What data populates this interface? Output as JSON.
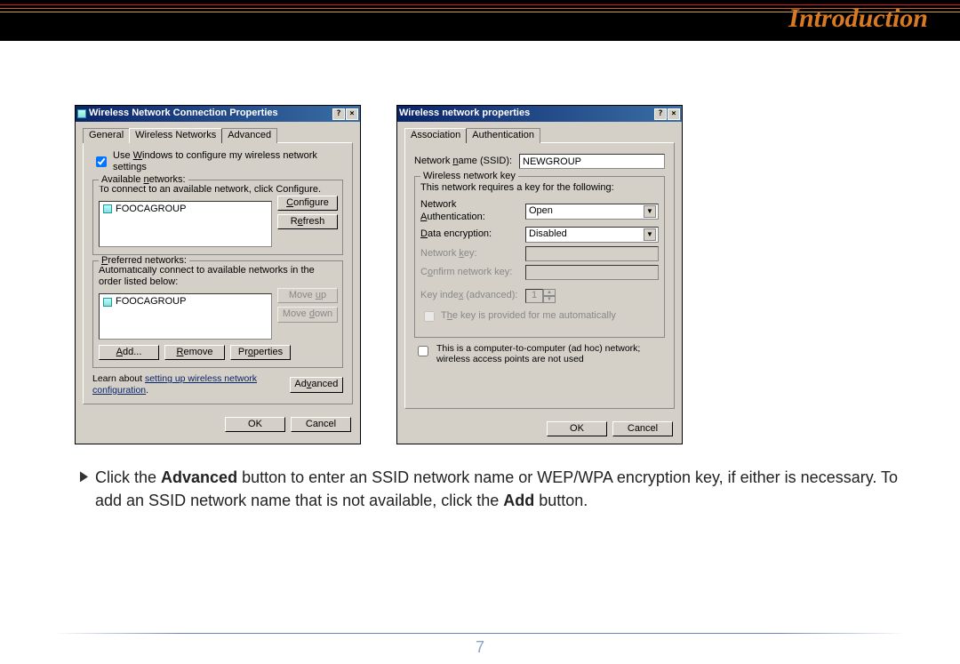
{
  "page_title": "Introduction",
  "page_number": "7",
  "instruction": {
    "pre1": "Click the ",
    "bold1": "Advanced",
    "mid": " button to enter an SSID network name or WEP/WPA encryption key, if either is necessary.  To add an SSID network name that is not available, click the ",
    "bold2": "Add",
    "post": " button."
  },
  "dialog_left": {
    "title": "Wireless Network Connection Properties",
    "tabs": {
      "general": "General",
      "wireless": "Wireless Networks",
      "advanced": "Advanced"
    },
    "use_windows": "Use Windows to configure my wireless network settings",
    "available_networks": "Available networks:",
    "to_connect": "To connect to an available network, click Configure.",
    "item1": "FOOCAGROUP",
    "configure": "Configure",
    "refresh": "Refresh",
    "preferred_networks": "Preferred networks:",
    "auto_connect": "Automatically connect to available networks in the order listed below:",
    "item2": "FOOCAGROUP",
    "moveup": "Move up",
    "movedown": "Move down",
    "add": "Add...",
    "remove": "Remove",
    "properties": "Properties",
    "learn_about": "Learn about ",
    "learn_link": "setting up wireless network configuration",
    "advanced_btn": "Advanced",
    "ok": "OK",
    "cancel": "Cancel"
  },
  "dialog_right": {
    "title": "Wireless network properties",
    "tabs": {
      "association": "Association",
      "authentication": "Authentication"
    },
    "ssid_label": "Network name (SSID):",
    "ssid_value": "NEWGROUP",
    "wnkey": "Wireless network key",
    "requires": "This network requires a key for the following:",
    "net_auth_label": "Network Authentication:",
    "net_auth_value": "Open",
    "data_enc_label": "Data encryption:",
    "data_enc_value": "Disabled",
    "netkey_label": "Network key:",
    "confirm_label": "Confirm network key:",
    "keyindex_label": "Key index (advanced):",
    "keyindex_value": "1",
    "autokey": "The key is provided for me automatically",
    "adhoc": "This is a computer-to-computer (ad hoc) network; wireless access points are not used",
    "ok": "OK",
    "cancel": "Cancel"
  }
}
